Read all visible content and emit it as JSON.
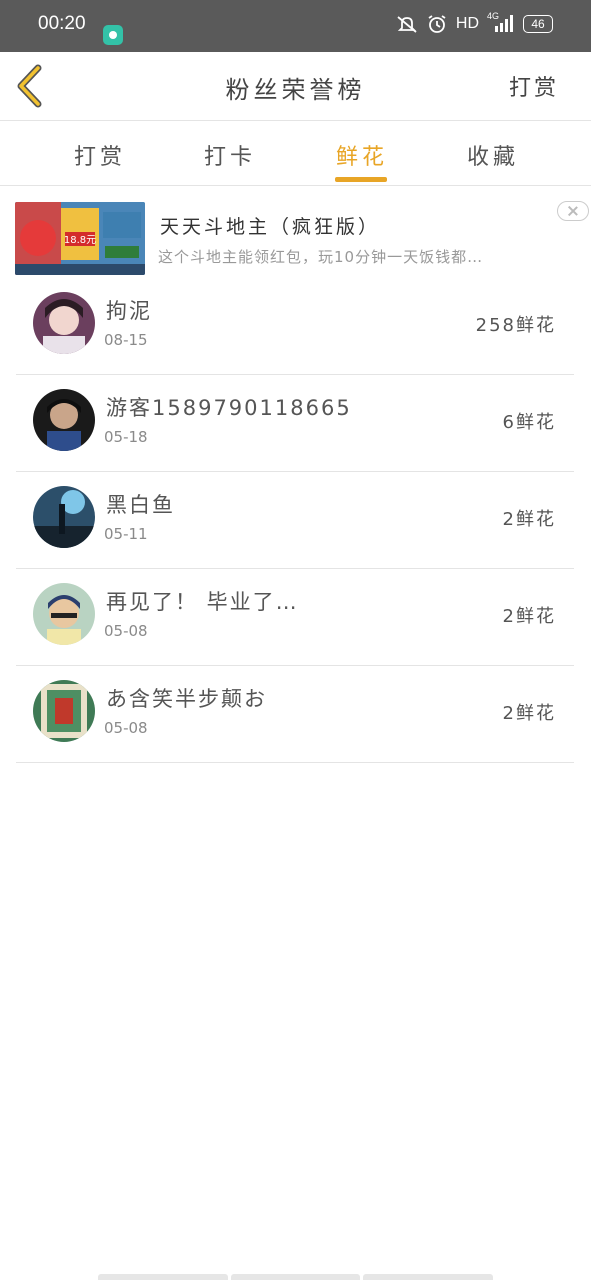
{
  "status_bar": {
    "time": "00:20",
    "hd": "HD",
    "network": "4G",
    "battery": "46"
  },
  "header": {
    "title": "粉丝荣誉榜",
    "action_label": "打赏"
  },
  "tabs": [
    {
      "label": "打赏",
      "active": false
    },
    {
      "label": "打卡",
      "active": false
    },
    {
      "label": "鲜花",
      "active": true
    },
    {
      "label": "收藏",
      "active": false
    }
  ],
  "ad": {
    "title": "天天斗地主（疯狂版）",
    "description": "这个斗地主能领红包，玩10分钟一天饭钱都…",
    "thumb_text": "18.8元"
  },
  "ranking": [
    {
      "name": "拘泥",
      "date": "08-15",
      "count": "258鲜花"
    },
    {
      "name": "游客1589790118665",
      "date": "05-18",
      "count": "6鲜花"
    },
    {
      "name": "黑白鱼",
      "date": "05-11",
      "count": "2鲜花"
    },
    {
      "name": "再见了！ 毕业了…",
      "date": "05-08",
      "count": "2鲜花"
    },
    {
      "name": "あ含笑半步颠お",
      "date": "05-08",
      "count": "2鲜花"
    }
  ],
  "colors": {
    "accent": "#e8a526",
    "status_bar": "#5a5a5a",
    "divider": "#e4e4e4"
  },
  "icons": {
    "back": "chevron-left-icon",
    "ad_close": "close-icon"
  }
}
